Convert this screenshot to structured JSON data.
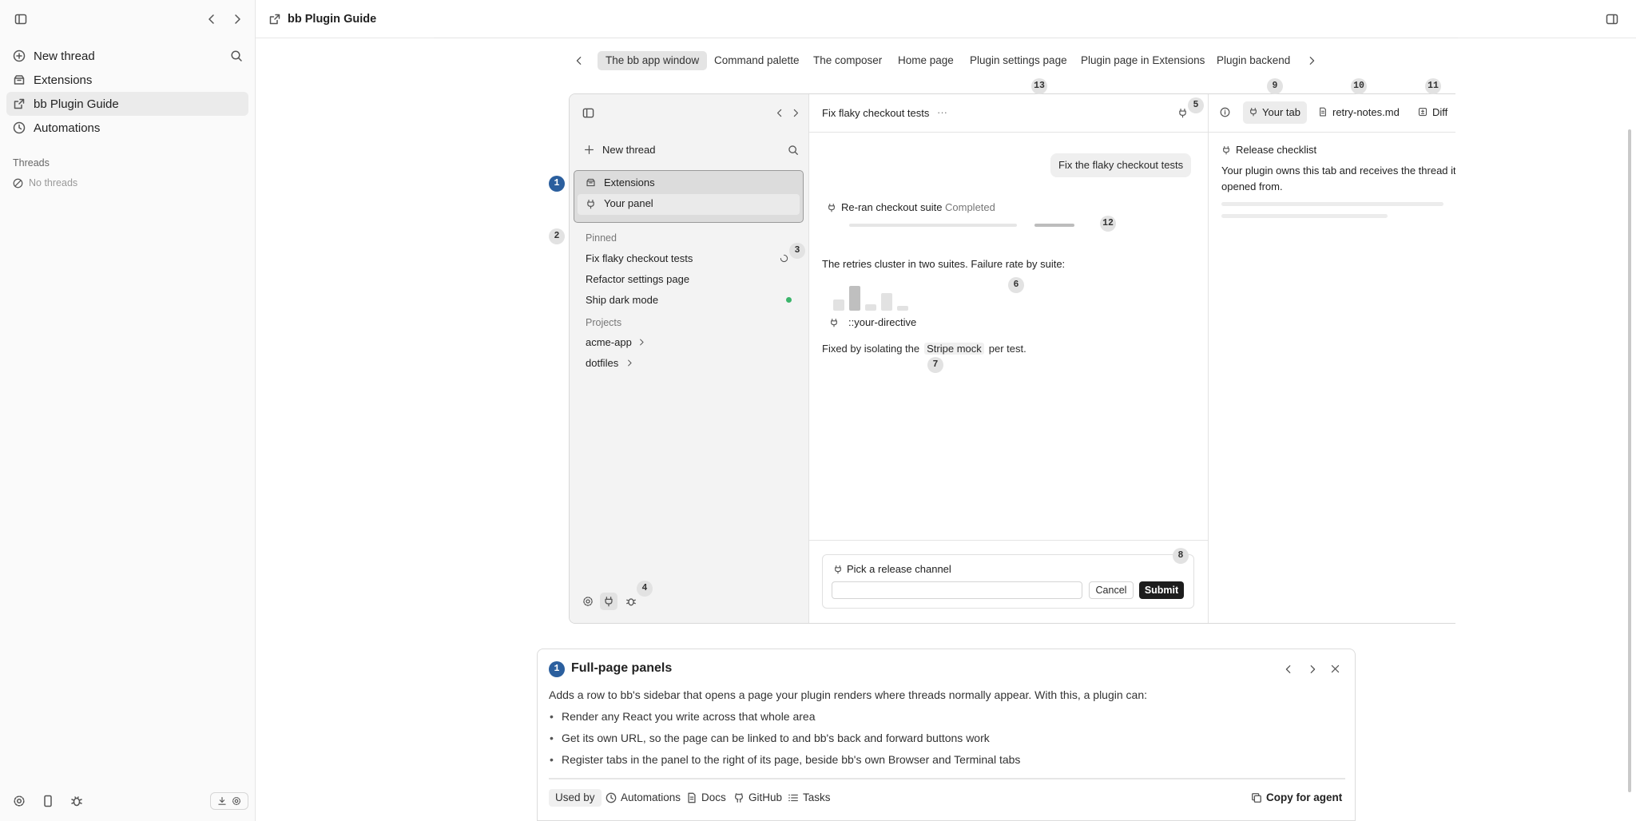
{
  "app": {
    "title": "bb Plugin Guide"
  },
  "outer_sidebar": {
    "items": [
      {
        "label": "New thread",
        "icon": "plus-circle-icon"
      },
      {
        "label": "Extensions",
        "icon": "box-icon"
      },
      {
        "label": "bb Plugin Guide",
        "icon": "external-page-icon"
      },
      {
        "label": "Automations",
        "icon": "clock-icon"
      }
    ],
    "threads_heading": "Threads",
    "no_threads": "No threads"
  },
  "tabs": [
    "The bb app window",
    "Command palette",
    "The composer",
    "Home page",
    "Plugin settings page",
    "Plugin page in Extensions",
    "Plugin backend"
  ],
  "badges": [
    "1",
    "2",
    "3",
    "4",
    "5",
    "6",
    "7",
    "8",
    "9",
    "10",
    "11",
    "12",
    "13"
  ],
  "mock": {
    "new_thread": "New thread",
    "extensions": "Extensions",
    "your_panel": "Your panel",
    "pinned": "Pinned",
    "pinned_items": [
      "Fix flaky checkout tests",
      "Refactor settings page",
      "Ship dark mode"
    ],
    "projects": "Projects",
    "project_items": [
      "acme-app",
      "dotfiles"
    ],
    "thread_title": "Fix flaky checkout tests",
    "thread_menu": "···",
    "user_message": "Fix the flaky checkout tests",
    "tool_name": "Re-ran checkout suite",
    "tool_status": "Completed",
    "analysis": "The retries cluster in two suites. Failure rate by suite:",
    "directive": "::your-directive",
    "fixed_prefix": "Fixed by isolating the",
    "fixed_code": "Stripe mock",
    "fixed_suffix": "per test.",
    "prompt_title": "Pick a release channel",
    "cancel": "Cancel",
    "submit": "Submit",
    "right_tabs": [
      "Your tab",
      "retry-notes.md",
      "Diff"
    ],
    "release_title": "Release checklist",
    "release_body_1": "Your plugin owns this tab and receives the thread it",
    "release_body_2": "opened from."
  },
  "tour": {
    "step": "1",
    "title": "Full-page panels",
    "intro": "Adds a row to bb's sidebar that opens a page your plugin renders where threads normally appear. With this, a plugin can:",
    "bullets": [
      "Render any React you write across that whole area",
      "Get its own URL, so the page can be linked to and bb's back and forward buttons work",
      "Register tabs in the panel to the right of its page, beside bb's own Browser and Terminal tabs"
    ],
    "used_by": "Used by",
    "links": [
      "Automations",
      "Docs",
      "GitHub",
      "Tasks"
    ],
    "copy": "Copy for agent"
  },
  "colors": {
    "accent": "#2b5f9e",
    "status_dot": "#3bb56b",
    "submit_bg": "#1d1d1d"
  }
}
